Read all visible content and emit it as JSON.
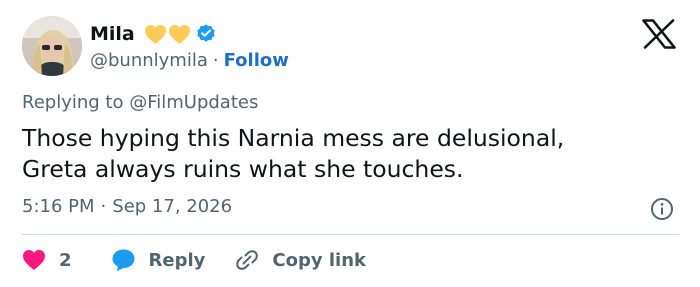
{
  "author": {
    "display_name": "Mila",
    "handle": "@bunnlymila",
    "follow_label": "Follow",
    "separator": "·",
    "name_emojis": [
      "yellow-heart-icon",
      "yellow-heart-icon"
    ],
    "verified": true
  },
  "reply_context": {
    "text": "Replying to @FilmUpdates"
  },
  "tweet": {
    "lines": [
      "Those hyping this Narnia mess are delusional,",
      "Greta always ruins what she touches."
    ],
    "time": "5:16 PM",
    "separator": "·",
    "date": "Sep 17, 2026"
  },
  "actions": {
    "like_count": "2",
    "reply_label": "Reply",
    "copy_link_label": "Copy link"
  },
  "colors": {
    "text_primary": "#0f1419",
    "text_secondary": "#536471",
    "link_blue": "#1d6fc7",
    "verified_blue": "#1d9bf0",
    "heart_yellow": "#fdcb58",
    "like_pink": "#f91880",
    "divider": "#cfd9de"
  },
  "icons": {
    "logo": "x-logo-icon",
    "info": "info-icon",
    "like": "heart-icon",
    "reply": "speech-bubble-icon",
    "copy": "link-icon"
  }
}
